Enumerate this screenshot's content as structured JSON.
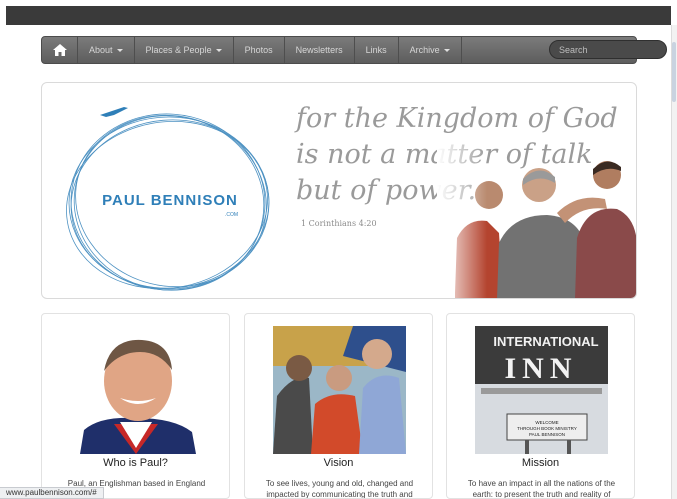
{
  "nav": {
    "items": [
      {
        "label": "About",
        "dropdown": true
      },
      {
        "label": "Places & People",
        "dropdown": true
      },
      {
        "label": "Photos",
        "dropdown": false
      },
      {
        "label": "Newsletters",
        "dropdown": false
      },
      {
        "label": "Links",
        "dropdown": false
      },
      {
        "label": "Archive",
        "dropdown": true
      }
    ],
    "search_placeholder": "Search"
  },
  "hero": {
    "logo_name": "PAUL BENNISON",
    "logo_domain": ".COM",
    "quote_line1": "for the Kingdom of God",
    "quote_line2": "is not a matter of talk",
    "quote_line3": "but of power.",
    "reference": "1 Corinthians 4:20"
  },
  "cards": [
    {
      "title": "Who is Paul?",
      "text": "Paul, an Englishman based in England"
    },
    {
      "title": "Vision",
      "text": "To see lives, young and old, changed and impacted by communicating the truth and"
    },
    {
      "title": "Mission",
      "text": "To have an impact in all the nations of the earth: to present the truth and reality of",
      "sign_line1": "INTERNATIONAL",
      "sign_line2": "INN",
      "plaque": "WELCOME THROUGH BOOK MINISTRY PAUL BENNISON"
    }
  ],
  "status_url": "www.paulbennison.com/#",
  "colors": {
    "navbar": "#6b6b6b",
    "logo_blue": "#2f7fb8",
    "quote_gray": "#9a9a9a"
  }
}
